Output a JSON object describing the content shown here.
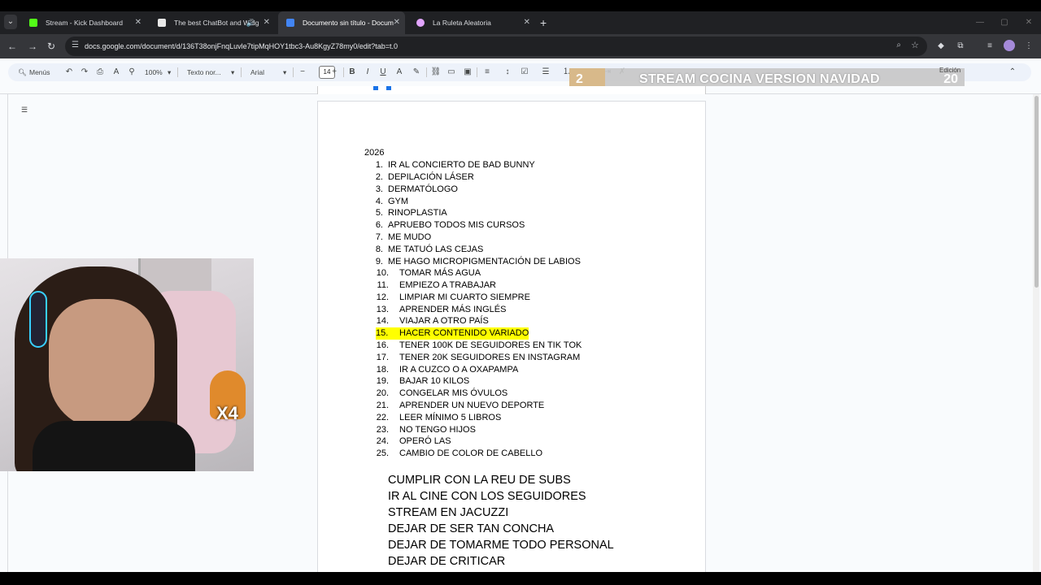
{
  "browser": {
    "tabs": [
      {
        "title": "Stream - Kick Dashboard",
        "favicon_color": "#53fc18",
        "active": false
      },
      {
        "title": "The best ChatBot and Widg",
        "favicon_color": "#e8e8e8",
        "active": false
      },
      {
        "title": "Documento sin título - Docum",
        "favicon_color": "#4285f4",
        "active": true
      },
      {
        "title": "La Ruleta Aleatoria",
        "favicon_color": "#e2a5ff",
        "active": false
      }
    ],
    "url": "docs.google.com/document/d/136T38onjFnqLuvle7tipMqHOY1tbc3-Au8KgyZ78my0/edit?tab=t.0"
  },
  "toolbar": {
    "menus_label": "Menús",
    "zoom": "100%",
    "style": "Texto nor...",
    "font": "Arial",
    "font_size": "14",
    "mode": "Edición"
  },
  "overlay": {
    "left_number": "2",
    "title": "STREAM COCINA VERSION NAVIDAD",
    "right_number": "20"
  },
  "webcam": {
    "multiplier": "X4"
  },
  "document": {
    "year": "2026",
    "goals": [
      {
        "n": "1.",
        "text": "IR AL CONCIERTO DE BAD BUNNY"
      },
      {
        "n": "2.",
        "text": "DEPILACIÓN LÁSER"
      },
      {
        "n": "3.",
        "text": "DERMATÓLOGO"
      },
      {
        "n": "4.",
        "text": "GYM"
      },
      {
        "n": "5.",
        "text": "RINOPLASTIA"
      },
      {
        "n": "6.",
        "text": "APRUEBO TODOS MIS CURSOS"
      },
      {
        "n": "7.",
        "text": "ME MUDO"
      },
      {
        "n": "8.",
        "text": "ME TATUÓ LAS CEJAS"
      },
      {
        "n": "9.",
        "text": "ME HAGO MICROPIGMENTACIÓN DE LABIOS"
      },
      {
        "n": "10.",
        "text": "TOMAR MÁS AGUA"
      },
      {
        "n": "11.",
        "text": "EMPIEZO A TRABAJAR"
      },
      {
        "n": "12.",
        "text": "LIMPIAR MI CUARTO SIEMPRE"
      },
      {
        "n": "13.",
        "text": "APRENDER MÁS INGLÉS"
      },
      {
        "n": "14.",
        "text": "VIAJAR A OTRO PAÍS"
      },
      {
        "n": "15.",
        "text": "HACER CONTENIDO VARIADO",
        "highlight": true
      },
      {
        "n": "16.",
        "text": "TENER 100K DE SEGUIDORES EN TIK TOK"
      },
      {
        "n": "17.",
        "text": "TENER 20K SEGUIDORES EN INSTAGRAM"
      },
      {
        "n": "18.",
        "text": "IR A CUZCO O A OXAPAMPA"
      },
      {
        "n": "19.",
        "text": "BAJAR 10 KILOS"
      },
      {
        "n": "20.",
        "text": "CONGELAR MIS ÓVULOS"
      },
      {
        "n": "21.",
        "text": "APRENDER UN NUEVO DEPORTE"
      },
      {
        "n": "22.",
        "text": "LEER MÍNIMO 5 LIBROS"
      },
      {
        "n": "23.",
        "text": "NO TENGO HIJOS"
      },
      {
        "n": "24.",
        "text": "OPERÓ LAS"
      },
      {
        "n": "25.",
        "text": "CAMBIO DE COLOR DE CABELLO"
      }
    ],
    "extra_lines": [
      "CUMPLIR CON LA REU DE SUBS",
      "IR AL CINE CON LOS SEGUIDORES",
      "STREAM EN JACUZZI",
      "DEJAR DE SER TAN CONCHA",
      "DEJAR DE TOMARME TODO PERSONAL",
      "DEJAR DE CRITICAR"
    ]
  }
}
